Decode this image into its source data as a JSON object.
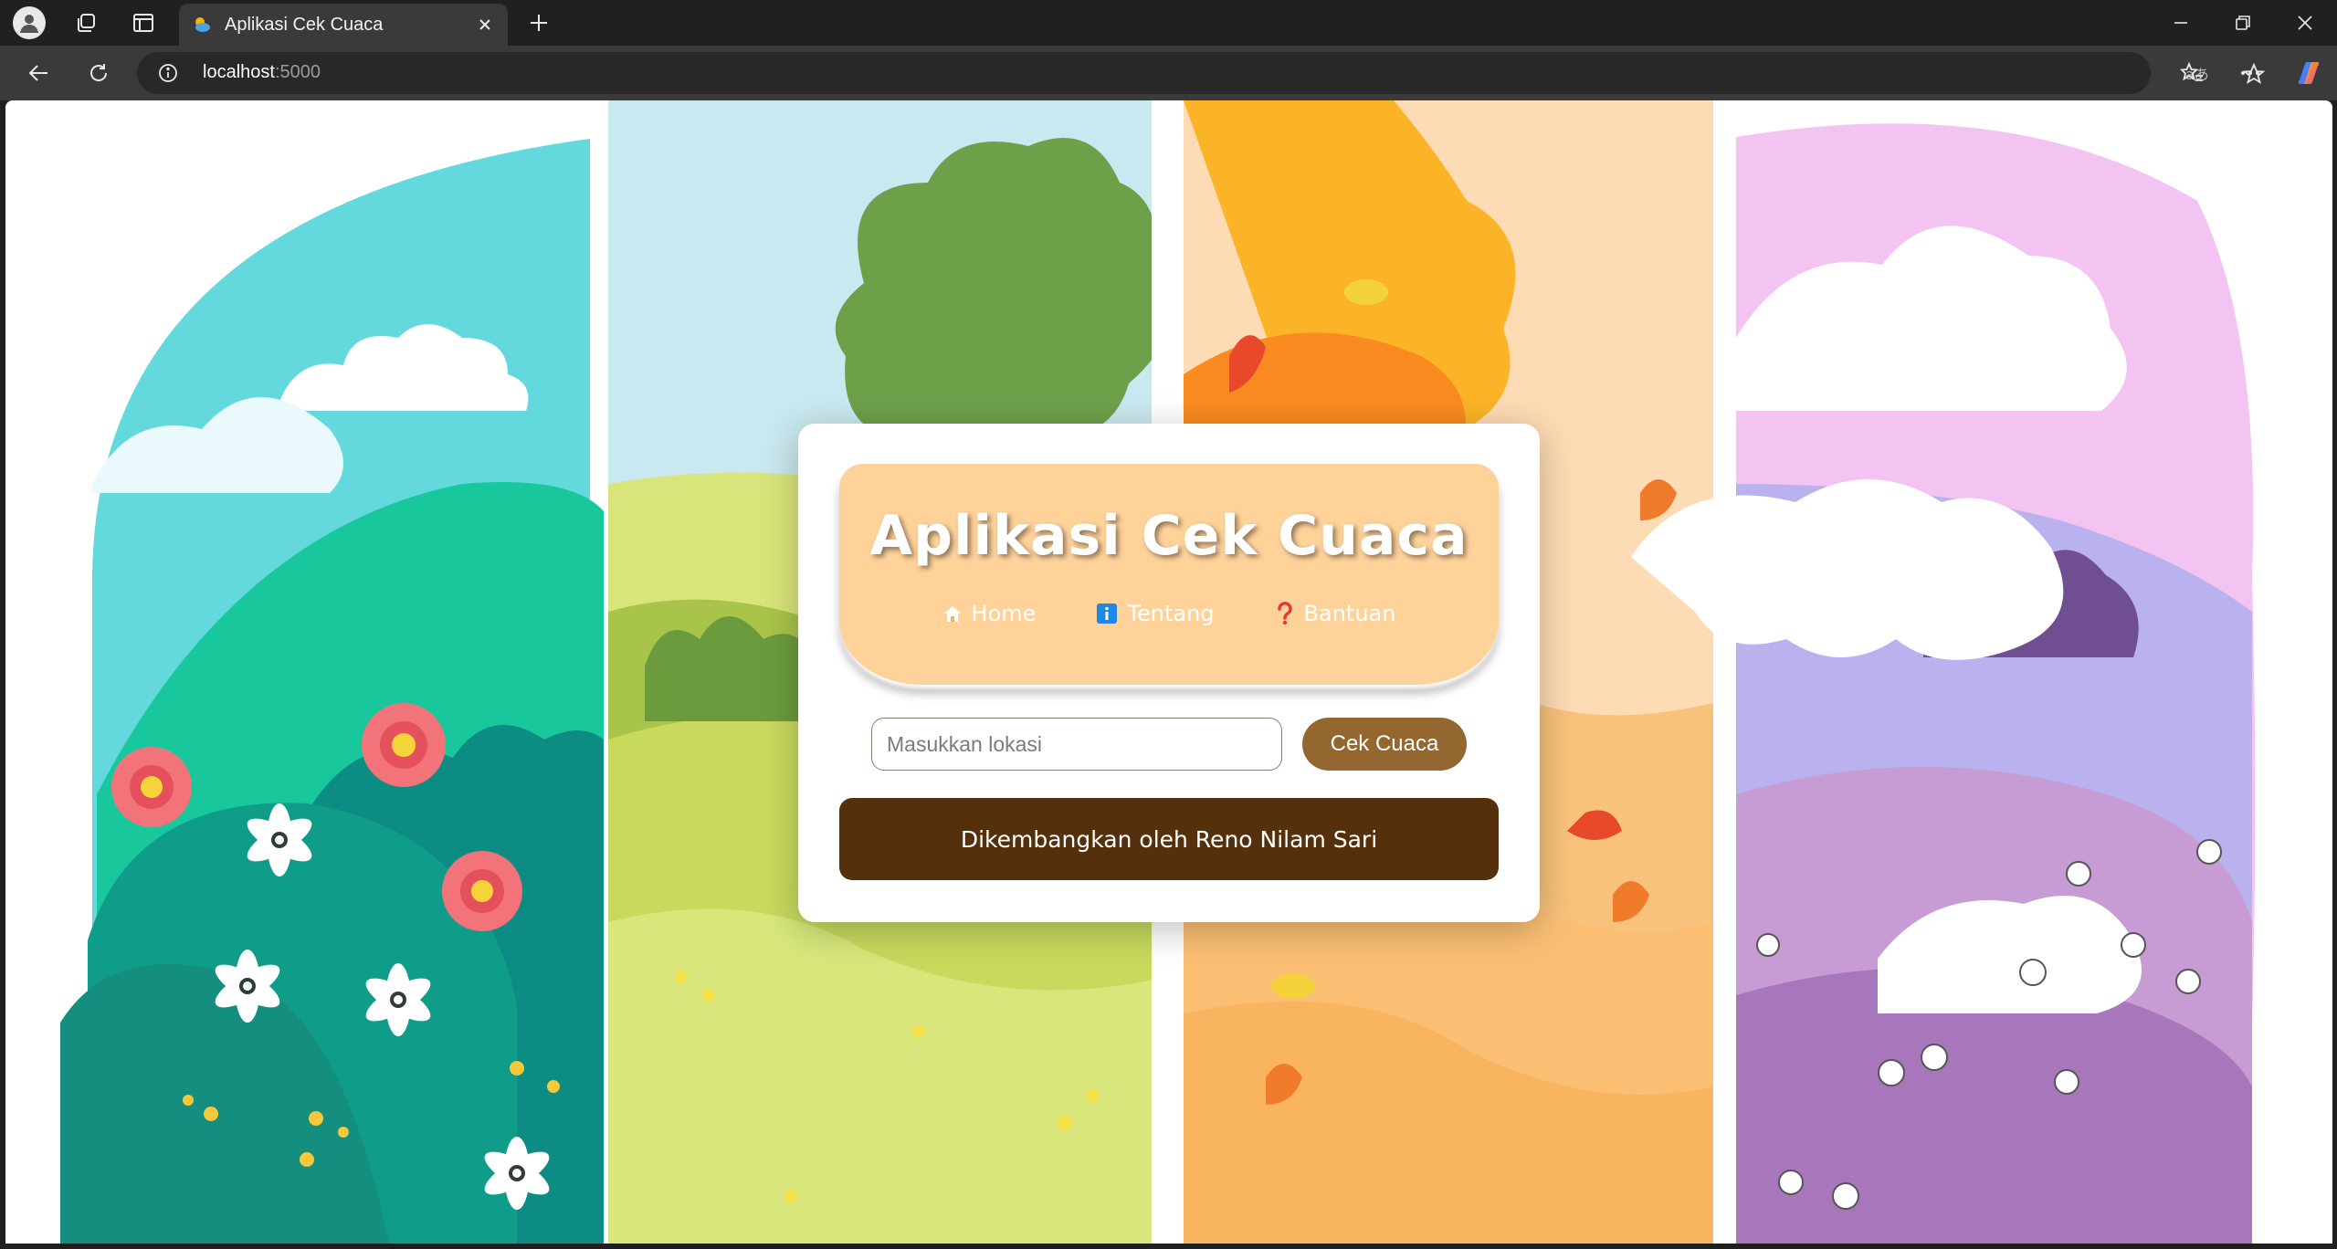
{
  "browser": {
    "tab_title": "Aplikasi Cek Cuaca",
    "url_host": "localhost",
    "url_port": ":5000"
  },
  "icons": {
    "profile": "profile-icon",
    "workspaces": "workspaces-icon",
    "vertical_tabs": "vertical-tabs-icon",
    "new_tab": "plus-icon",
    "back": "arrow-left-icon",
    "reload": "reload-icon",
    "site_info": "info-icon",
    "read_aloud": "read-aloud-icon",
    "favorite": "star-icon",
    "favorites": "favorites-icon",
    "more": "ellipsis-icon",
    "copilot": "copilot-icon"
  },
  "app": {
    "title": "Aplikasi Cek Cuaca",
    "nav": [
      {
        "label": "Home",
        "icon": "house-icon"
      },
      {
        "label": "Tentang",
        "icon": "info-icon"
      },
      {
        "label": "Bantuan",
        "icon": "question-mark-icon"
      }
    ],
    "search": {
      "placeholder": "Masukkan lokasi",
      "value": ""
    },
    "button_label": "Cek Cuaca",
    "footer": "Dikembangkan oleh Reno Nilam Sari"
  },
  "colors": {
    "header_bg": "#ffd29a",
    "button_bg": "#93672f",
    "footer_bg": "#55300c",
    "info_blue": "#1e88e5",
    "question_red": "#e53935"
  }
}
